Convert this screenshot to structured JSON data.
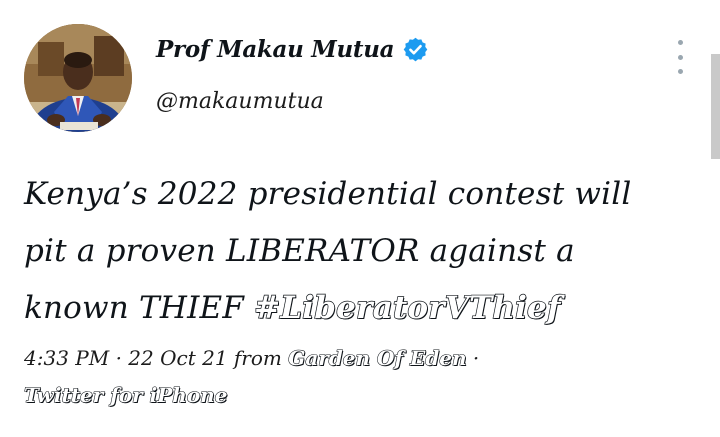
{
  "tweet": {
    "author": {
      "display_name": "Prof Makau Mutua",
      "handle": "@makaumutua",
      "verified": true
    },
    "text_parts": {
      "line1": "Kenya’s 2022 presidential contest will",
      "line2": "pit a proven LIBERATOR against a",
      "line3_prefix": "known THIEF ",
      "hashtag": "#LiberatorVThief"
    },
    "meta": {
      "time": "4:33 PM",
      "separator": " · ",
      "date": "22 Oct 21",
      "from_label": " from ",
      "location": "Garden Of Eden",
      "source": "Twitter for iPhone"
    }
  },
  "colors": {
    "text": "#0f1419",
    "verified_badge": "#1d9bf0",
    "menu_dots": "#9aa7b0",
    "scrollbar": "#c9c9c9"
  },
  "icons": {
    "verified": "verified-badge-icon",
    "more": "more-vertical-icon"
  }
}
